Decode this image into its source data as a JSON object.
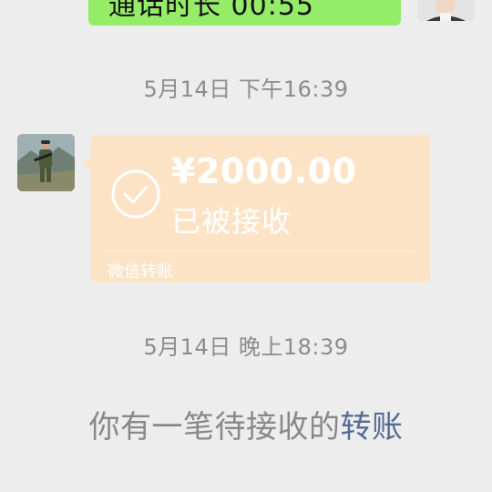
{
  "top_call": {
    "text": "通话时长 00:55"
  },
  "timestamps": {
    "first": "5月14日 下午16:39",
    "second": "5月14日 晚上18:39"
  },
  "transfer": {
    "amount": "¥2000.00",
    "status": "已被接收",
    "footer": "微信转账",
    "icon": "check-circle-icon"
  },
  "system_message": {
    "text": "你有一笔待接收的",
    "link": "转账"
  },
  "colors": {
    "background": "#ededed",
    "outgoing_bubble": "#95ec69",
    "transfer_card": "#fde3c6",
    "link": "#576b95",
    "timestamp": "#8c8c8c"
  }
}
